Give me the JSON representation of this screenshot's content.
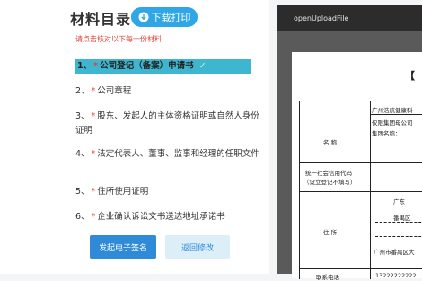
{
  "left": {
    "title": "材料目录",
    "download_label": "下载打印",
    "hint": "请点击核对以下每一份材料",
    "materials": [
      {
        "num": "1、",
        "label": "公司登记（备案）申请书",
        "active": true
      },
      {
        "num": "2、",
        "label": "公司章程"
      },
      {
        "num": "3、",
        "label": "股东、发起人的主体资格证明或自然人身份证明"
      },
      {
        "num": "4、",
        "label": "法定代表人、董事、监事和经理的任职文件"
      },
      {
        "num": "5、",
        "label": "住所使用证明"
      },
      {
        "num": "6、",
        "label": "企业确认诉讼文书送达地址承诺书"
      }
    ],
    "primary_button": "发起电子签名",
    "secondary_button": "返回修改",
    "check_mark": "✓",
    "star": "*"
  },
  "viewer": {
    "title": "openUploadFile",
    "doc": {
      "bracket": "【",
      "name_label": "名    称",
      "name_value": "广州浩航健康科",
      "group_line1": "仅限集团母公司",
      "group_line2": "集团名称：",
      "credit_label_1": "统一社会信用代码",
      "credit_label_2": "（设立登记不填写）",
      "address_label": "住    所",
      "province": "广东",
      "district": "番禺区",
      "address_line": "广州市番禺区大",
      "phone_label": "联系电话",
      "phone_value": "13222222222"
    }
  },
  "colors": {
    "accent": "#2fa6e6",
    "active_row": "#3fb6cf",
    "required_star": "#e0433a",
    "primary_button": "#2f8ad8",
    "viewer_bar": "#2c2c2c"
  }
}
